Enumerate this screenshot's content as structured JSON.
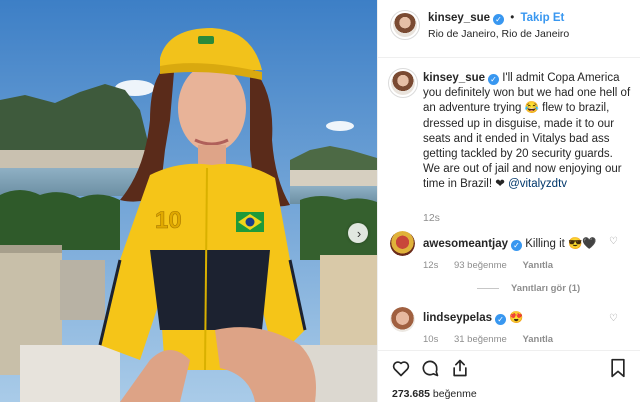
{
  "post": {
    "author": {
      "username": "kinsey_sue",
      "follow_label": "Takip Et",
      "location": "Rio de Janeiro, Rio de Janeiro",
      "separator": "•"
    },
    "caption": {
      "text_before": "I'll admit Copa America you definitely won but we had one hell of an adventure trying 😂 flew to brazil, dressed up in disguise, made it to our seats and it ended in Vitalys bad ass getting tackled by 20 security guards. We are out of jail and now enjoying our time in Brazil! ❤",
      "mention": "@vitalyzdtv",
      "time": "12s"
    },
    "comments": [
      {
        "username": "awesomeantjay",
        "text": "Killing it 😎🖤",
        "time": "12s",
        "likes": "93 beğenme",
        "reply_label": "Yanıtla",
        "view_replies": "Yanıtları gör (1)"
      },
      {
        "username": "lindseypelas",
        "text": "😍",
        "time": "10s",
        "likes": "31 beğenme",
        "reply_label": "Yanıtla"
      }
    ],
    "likes_count": "273.685",
    "likes_label": "beğenme"
  },
  "icons": {
    "verified": "verified-badge-icon",
    "next": "chevron-right-icon",
    "heart": "heart-icon",
    "comment": "comment-icon",
    "share": "share-icon",
    "save": "bookmark-icon"
  },
  "glyphs": {
    "verified": "✓",
    "next": "›",
    "heart_small": "♡"
  },
  "colors": {
    "link": "#3897f0",
    "secondary_text": "#8e8e8e",
    "border": "#efefef",
    "jersey_yellow": "#f5c518",
    "jersey_navy": "#1c2230"
  }
}
